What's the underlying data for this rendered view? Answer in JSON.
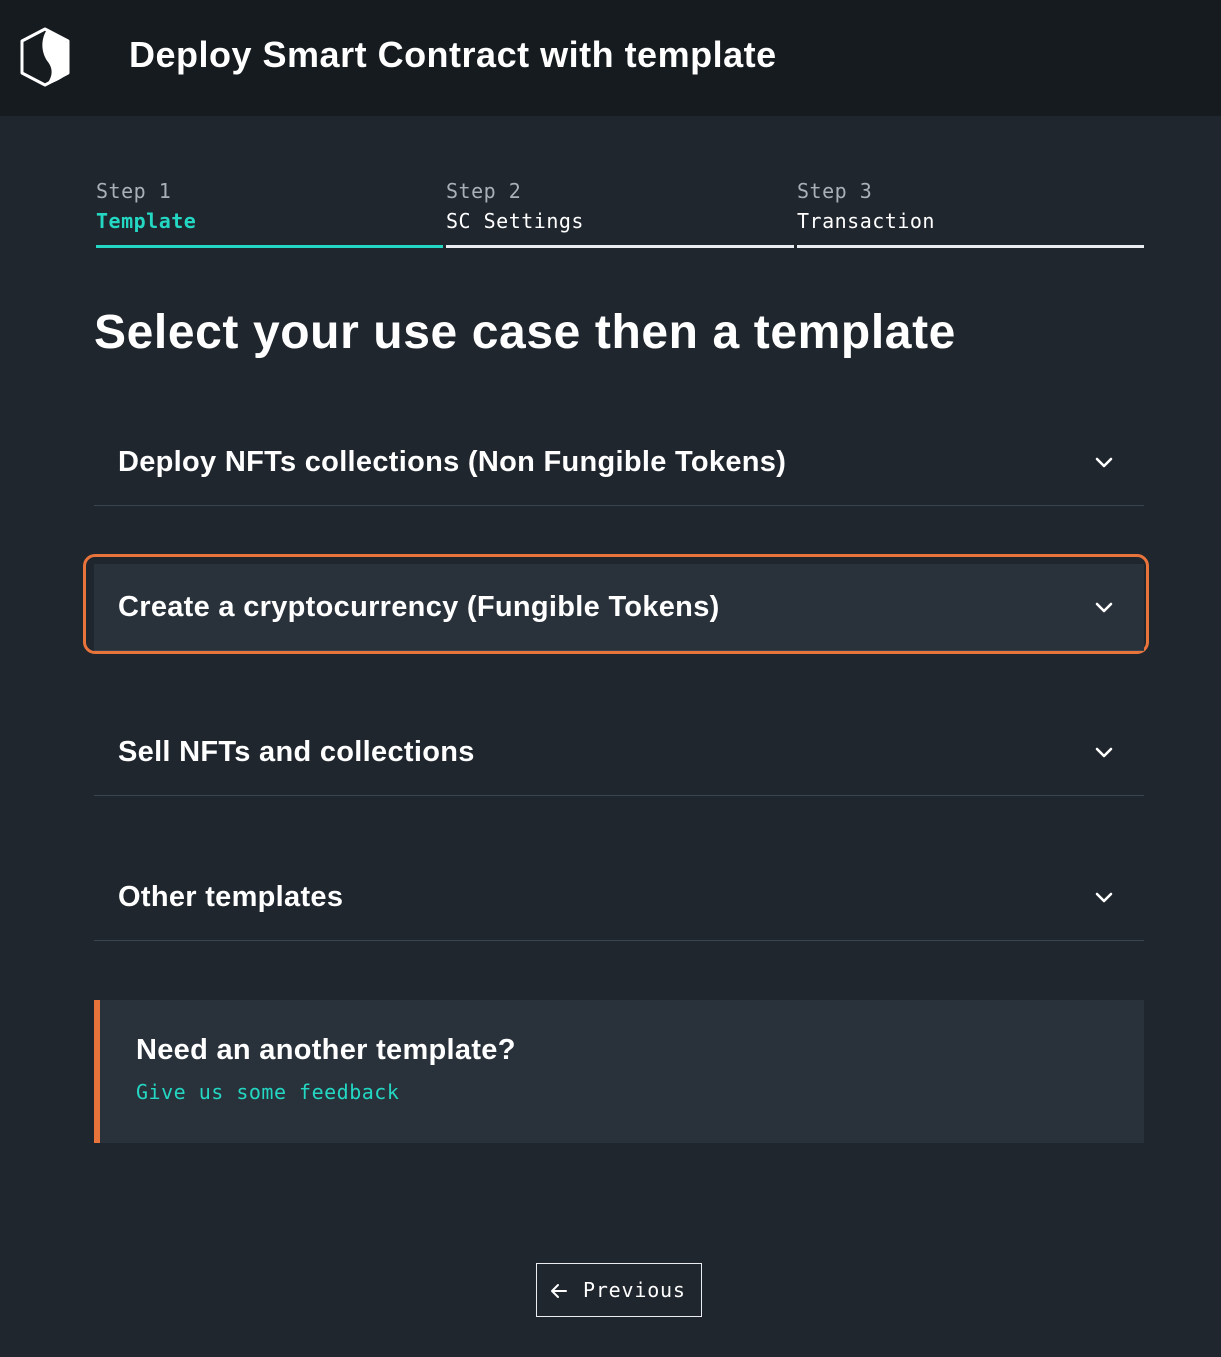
{
  "header": {
    "logo_icon": "logo-icon",
    "title": "Deploy Smart Contract with template"
  },
  "steps": [
    {
      "number": "Step 1",
      "label": "Template",
      "active": true
    },
    {
      "number": "Step 2",
      "label": "SC Settings",
      "active": false
    },
    {
      "number": "Step 3",
      "label": "Transaction",
      "active": false
    }
  ],
  "main": {
    "heading": "Select your use case then a template",
    "use_cases": [
      {
        "label": "Deploy NFTs collections (Non Fungible Tokens)",
        "icon": "chevron-down-icon",
        "focused": false
      },
      {
        "label": "Create a cryptocurrency (Fungible Tokens)",
        "icon": "chevron-down-icon",
        "focused": true
      },
      {
        "label": "Sell NFTs and collections",
        "icon": "chevron-down-icon",
        "focused": false
      },
      {
        "label": "Other templates",
        "icon": "chevron-down-icon",
        "focused": false
      }
    ]
  },
  "feedback": {
    "title": "Need an another template?",
    "link": "Give us some feedback"
  },
  "footer": {
    "previous_label": "Previous",
    "previous_icon": "arrow-left-icon"
  },
  "colors": {
    "background": "#1f262e",
    "header_background": "#161b20",
    "accent_teal": "#23d7c3",
    "accent_orange": "#e8743b",
    "panel": "#29323b"
  }
}
